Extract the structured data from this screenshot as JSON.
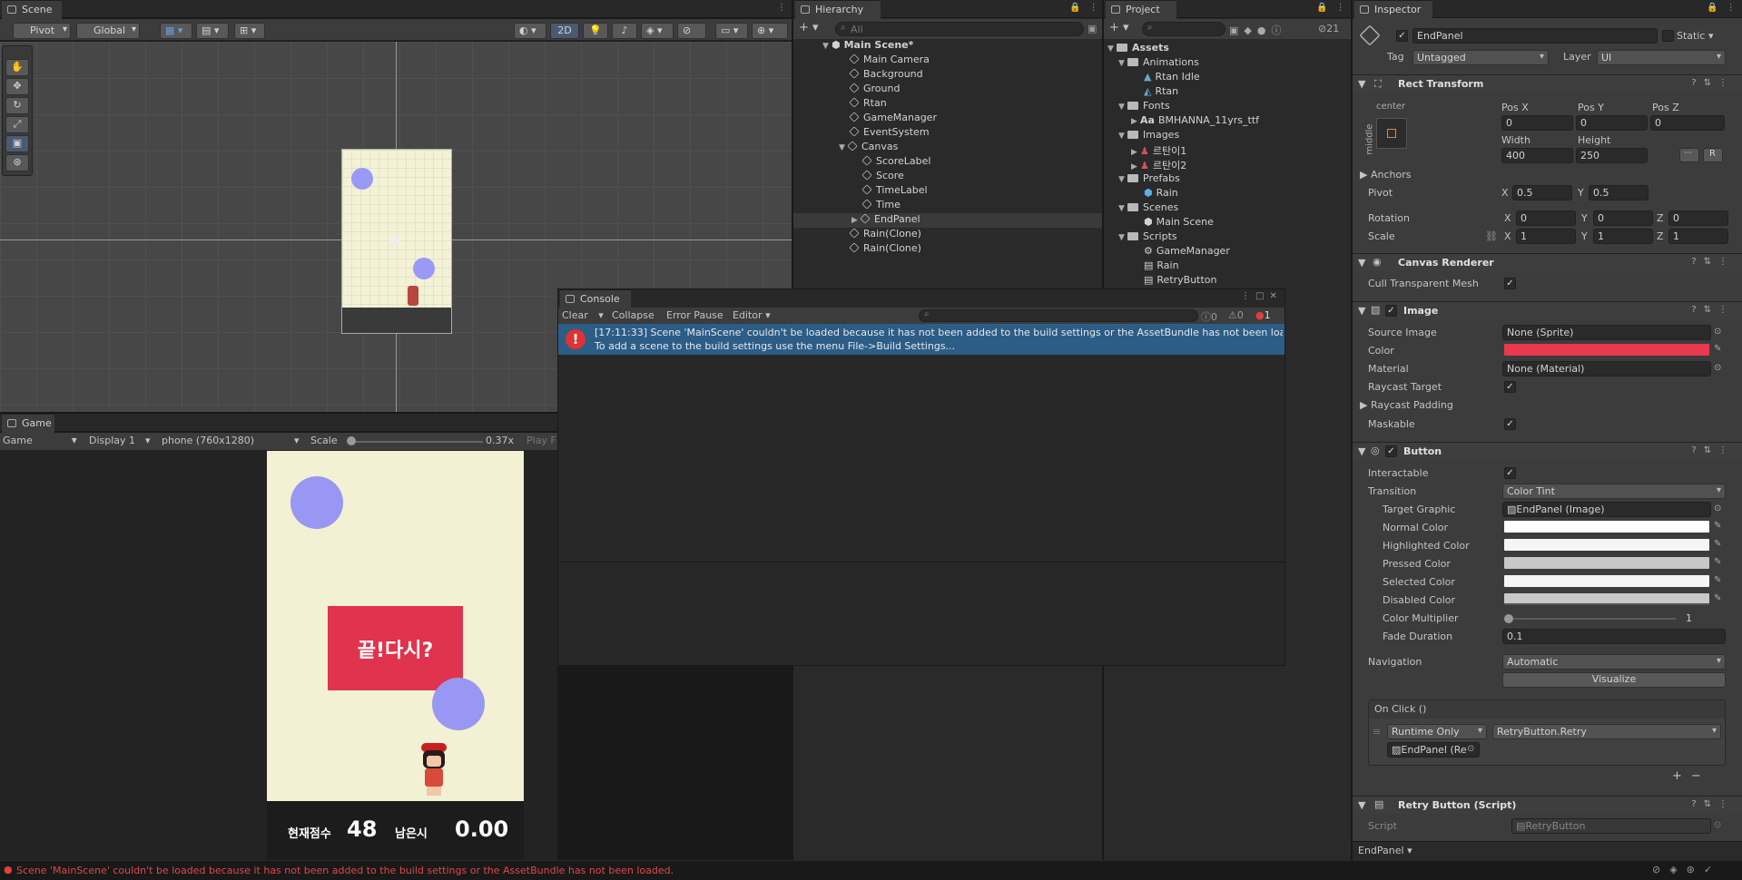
{
  "scene": {
    "tab": "Scene",
    "pivot": "Pivot",
    "global": "Global",
    "mode2d": "2D"
  },
  "game": {
    "tab": "Game",
    "display_mode": "Game",
    "display": "Display 1",
    "resolution": "phone (760x1280)",
    "scale_label": "Scale",
    "scale_value": "0.37x",
    "play": "Play F",
    "end_text": "끝!다시?",
    "score_label": "현재점수",
    "score_value": "48",
    "time_label": "남은시",
    "time_value": "0.00"
  },
  "hierarchy": {
    "tab": "Hierarchy",
    "search_placeholder": "All",
    "items": [
      "Main Scene*",
      "Main Camera",
      "Background",
      "Ground",
      "Rtan",
      "GameManager",
      "EventSystem",
      "Canvas",
      "ScoreLabel",
      "Score",
      "TimeLabel",
      "Time",
      "EndPanel",
      "Rain(Clone)",
      "Rain(Clone)"
    ]
  },
  "project": {
    "tab": "Project",
    "badge": "21",
    "items": [
      "Assets",
      "Animations",
      "Rtan Idle",
      "Rtan",
      "Fonts",
      "BMHANNA_11yrs_ttf",
      "Images",
      "르탄이1",
      "르탄이2",
      "Prefabs",
      "Rain",
      "Scenes",
      "Main Scene",
      "Scripts",
      "GameManager",
      "Rain",
      "RetryButton"
    ]
  },
  "console": {
    "tab": "Console",
    "clear": "Clear",
    "collapse": "Collapse",
    "error_pause": "Error Pause",
    "editor": "Editor",
    "count_log": "0",
    "count_warn": "0",
    "count_err": "1",
    "message_line1": "[17:11:33] Scene 'MainScene' couldn't be loaded because it has not been added to the build settings or the AssetBundle has not been loa",
    "message_line2": "To add a scene to the build settings use the menu File->Build Settings..."
  },
  "inspector": {
    "tab": "Inspector",
    "object_name": "EndPanel",
    "static": "Static",
    "tag_label": "Tag",
    "tag_value": "Untagged",
    "layer_label": "Layer",
    "layer_value": "UI",
    "rect": {
      "title": "Rect Transform",
      "anchor_h": "center",
      "anchor_v": "middle",
      "posx_l": "Pos X",
      "posy_l": "Pos Y",
      "posz_l": "Pos Z",
      "posx": "0",
      "posy": "0",
      "posz": "0",
      "width_l": "Width",
      "height_l": "Height",
      "width": "400",
      "height": "250",
      "r": "R",
      "anchors": "Anchors",
      "pivot": "Pivot",
      "pivot_x": "0.5",
      "pivot_y": "0.5",
      "rotation": "Rotation",
      "rot_x": "0",
      "rot_y": "0",
      "rot_z": "0",
      "scale": "Scale",
      "sc_x": "1",
      "sc_y": "1",
      "sc_z": "1",
      "x": "X",
      "y": "Y",
      "z": "Z"
    },
    "canvas_renderer": {
      "title": "Canvas Renderer",
      "cull": "Cull Transparent Mesh"
    },
    "image": {
      "title": "Image",
      "source_l": "Source Image",
      "source": "None (Sprite)",
      "color_l": "Color",
      "color": "#e8394f",
      "material_l": "Material",
      "material": "None (Material)",
      "raycast_target": "Raycast Target",
      "raycast_padding": "Raycast Padding",
      "maskable": "Maskable"
    },
    "button": {
      "title": "Button",
      "interactable": "Interactable",
      "transition_l": "Transition",
      "transition": "Color Tint",
      "target_l": "Target Graphic",
      "target": "EndPanel (Image)",
      "normal": "Normal Color",
      "highlighted": "Highlighted Color",
      "pressed": "Pressed Color",
      "selected": "Selected Color",
      "disabled": "Disabled Color",
      "multiplier_l": "Color Multiplier",
      "multiplier": "1",
      "fade_l": "Fade Duration",
      "fade": "0.1",
      "navigation_l": "Navigation",
      "navigation": "Automatic",
      "visualize": "Visualize",
      "onclick": "On Click ()",
      "runtime": "Runtime Only",
      "method": "RetryButton.Retry",
      "obj": "EndPanel (Re"
    },
    "retry": {
      "title": "Retry Button (Script)",
      "script_l": "Script",
      "script": "RetryButton"
    },
    "footer": "EndPanel"
  },
  "status": {
    "message": "Scene 'MainScene' couldn't be loaded because it has not been added to the build settings or the AssetBundle has not been loaded."
  }
}
